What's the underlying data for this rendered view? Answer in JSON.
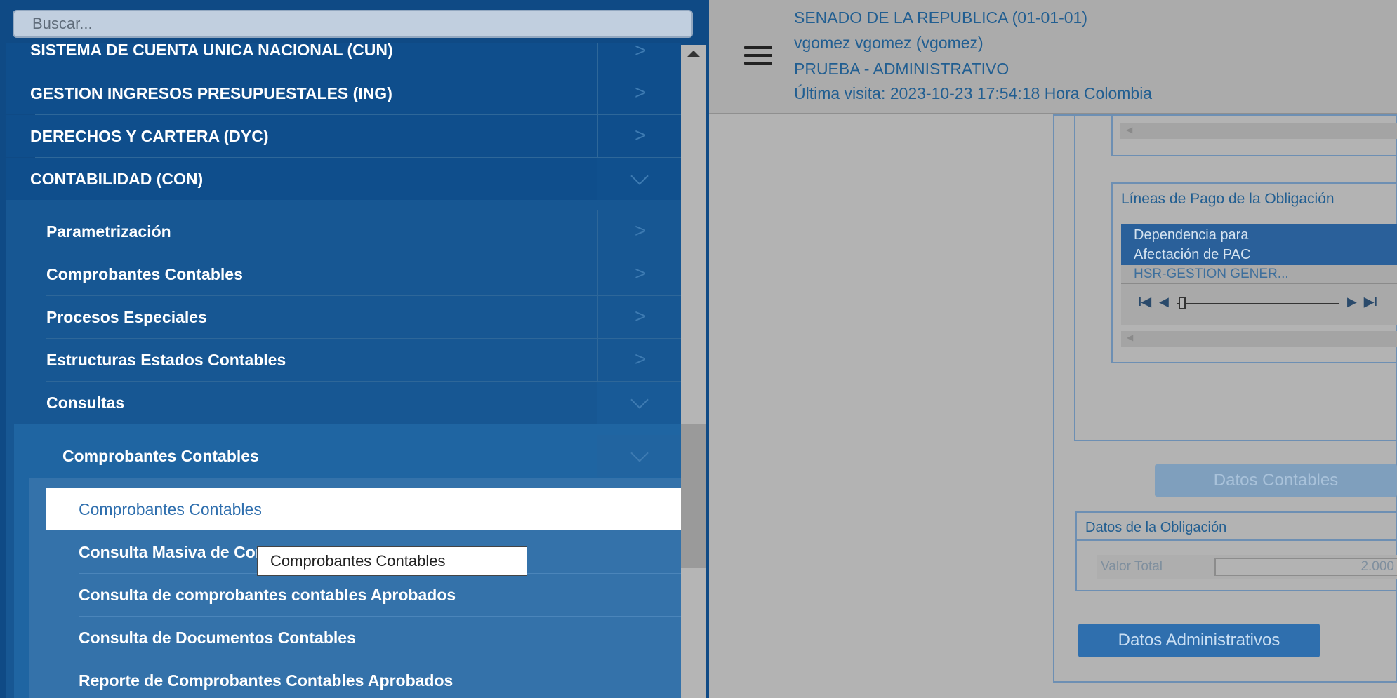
{
  "search": {
    "placeholder": "Buscar..."
  },
  "header": {
    "entity": "SENADO DE LA REPUBLICA (01-01-01)",
    "user": "vgomez vgomez (vgomez)",
    "environment": "PRUEBA - ADMINISTRATIVO",
    "last_visit": "Última visita: 2023-10-23 17:54:18 Hora Colombia"
  },
  "sidebar": {
    "modules": [
      {
        "label": "SISTEMA DE CUENTA UNICA NACIONAL (CUN)"
      },
      {
        "label": "GESTION INGRESOS PRESUPUESTALES (ING)"
      },
      {
        "label": "DERECHOS Y CARTERA (DYC)"
      },
      {
        "label": "CONTABILIDAD (CON)"
      }
    ],
    "con_items": [
      {
        "label": "Parametrización"
      },
      {
        "label": "Comprobantes Contables"
      },
      {
        "label": "Procesos Especiales"
      },
      {
        "label": "Estructuras Estados Contables"
      },
      {
        "label": "Consultas"
      }
    ],
    "consultas_items": [
      {
        "label": "Comprobantes Contables"
      }
    ],
    "leaf_items": [
      {
        "label": "Comprobantes Contables"
      },
      {
        "label": "Consulta Masiva de Comprobantes Contables"
      },
      {
        "label": "Consulta de comprobantes contables Aprobados"
      },
      {
        "label": "Consulta de Documentos Contables"
      },
      {
        "label": "Reporte de Comprobantes Contables Aprobados"
      }
    ]
  },
  "tooltip": {
    "text": "Comprobantes Contables"
  },
  "main": {
    "lineas_pago_title": "Líneas de Pago de la Obligación",
    "grid": {
      "header_line1": "Dependencia para",
      "header_line2": "Afectación de PAC",
      "row1": "HSR-GESTION GENER..."
    },
    "pager": {
      "first": "I◀",
      "prev": "◀",
      "next": "▶",
      "last": "▶I"
    },
    "datos_contables_button": "Datos Contables",
    "datos_obligacion_title": "Datos de la Obligación",
    "valor_total_label": "Valor Total",
    "valor_total_value": "2.000",
    "datos_administrativos_button": "Datos Administrativos"
  },
  "colors": {
    "sidebar_bg": "#0f4a85",
    "level1_bg": "#175793",
    "level2_bg": "#1f65a2",
    "level3_bg": "#3472aa",
    "selected_bg": "#ffffff",
    "header_text": "#215e91"
  }
}
